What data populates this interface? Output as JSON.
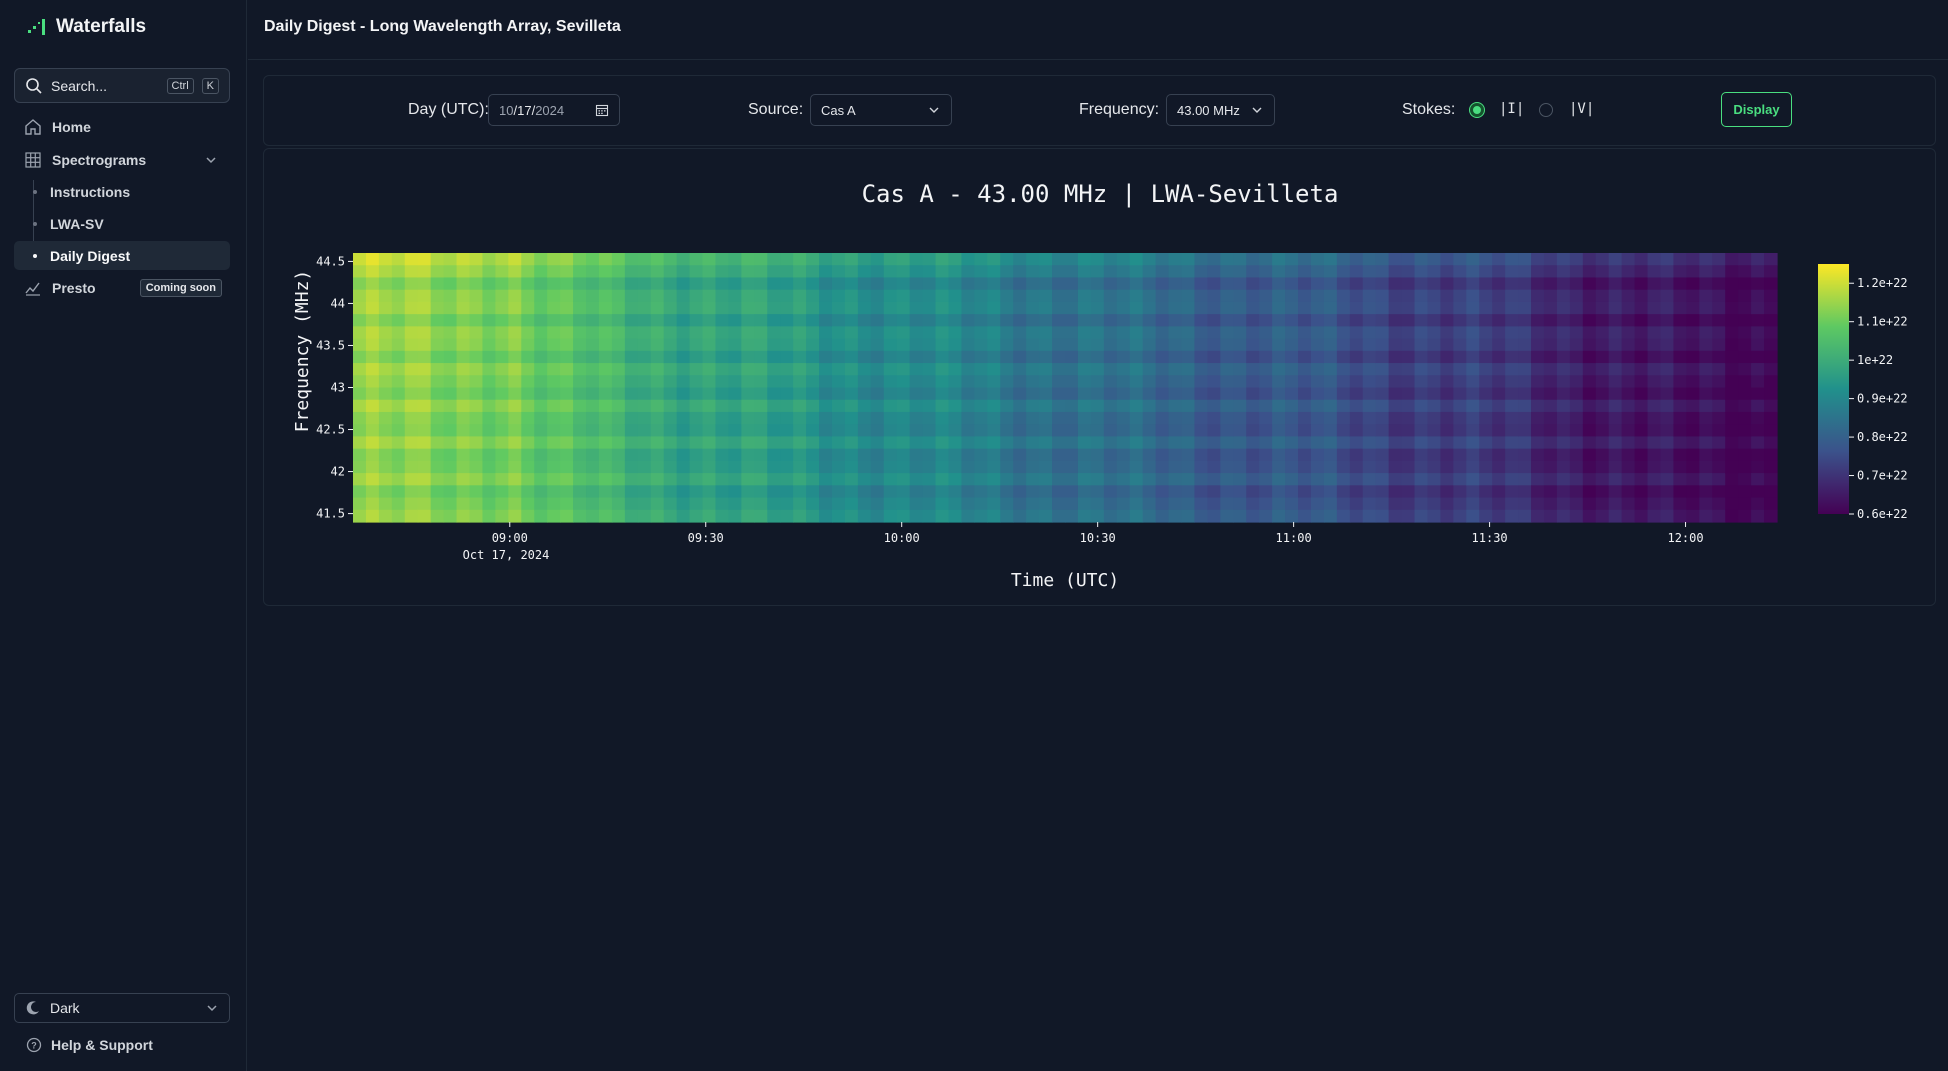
{
  "app": {
    "title": "Waterfalls"
  },
  "search": {
    "placeholder": "Search...",
    "kbd_ctrl": "Ctrl",
    "kbd_k": "K"
  },
  "sidebar": {
    "items": [
      {
        "label": "Home"
      },
      {
        "label": "Spectrograms"
      },
      {
        "label": "Instructions"
      },
      {
        "label": "LWA-SV"
      },
      {
        "label": "Daily Digest"
      },
      {
        "label": "Presto",
        "badge": "Coming soon"
      }
    ],
    "theme": "Dark",
    "help": "Help & Support"
  },
  "header": {
    "title": "Daily Digest - Long Wavelength Array, Sevilleta"
  },
  "controls": {
    "day_label": "Day (UTC):",
    "date": {
      "month": "10",
      "day": "17",
      "year": "2024",
      "sep": "/"
    },
    "source_label": "Source:",
    "source_value": "Cas A",
    "frequency_label": "Frequency:",
    "frequency_value": "43.00 MHz",
    "stokes_label": "Stokes:",
    "stokes_options": [
      "|I|",
      "|V|"
    ],
    "stokes_selected": "|I|",
    "display_label": "Display"
  },
  "colors": {
    "accent": "#4ade80",
    "background": "#111827"
  },
  "chart_data": {
    "type": "heatmap",
    "title": "Cas A - 43.00 MHz | LWA-Sevilleta",
    "xlabel": "Time (UTC)",
    "ylabel": "Frequency (MHz)",
    "x_ticks": [
      "09:00",
      "09:30",
      "10:00",
      "10:30",
      "11:00",
      "11:30",
      "12:00"
    ],
    "x_date_label": "Oct 17, 2024",
    "x_range": [
      "08:36",
      "12:14"
    ],
    "y_ticks": [
      "41.5",
      "42",
      "42.5",
      "43",
      "43.5",
      "44",
      "44.5"
    ],
    "ylim": [
      41.4,
      44.6
    ],
    "colorbar": {
      "colormap": "viridis",
      "ticks": [
        "0.6e+22",
        "0.7e+22",
        "0.8e+22",
        "0.9e+22",
        "1e+22",
        "1.1e+22",
        "1.2e+22"
      ],
      "range": [
        6e+21,
        1.25e+22
      ]
    },
    "profile_time_minutes": [
      0,
      15,
      24,
      30,
      40,
      60,
      90,
      120,
      150,
      180,
      200,
      218
    ],
    "profile_values": [
      1.15e+22,
      1.13e+22,
      1.14e+22,
      1.08e+22,
      1.03e+22,
      9.7e+21,
      9e+21,
      8.3e+21,
      7.7e+21,
      7e+21,
      6.4e+21,
      6.2e+21
    ]
  }
}
